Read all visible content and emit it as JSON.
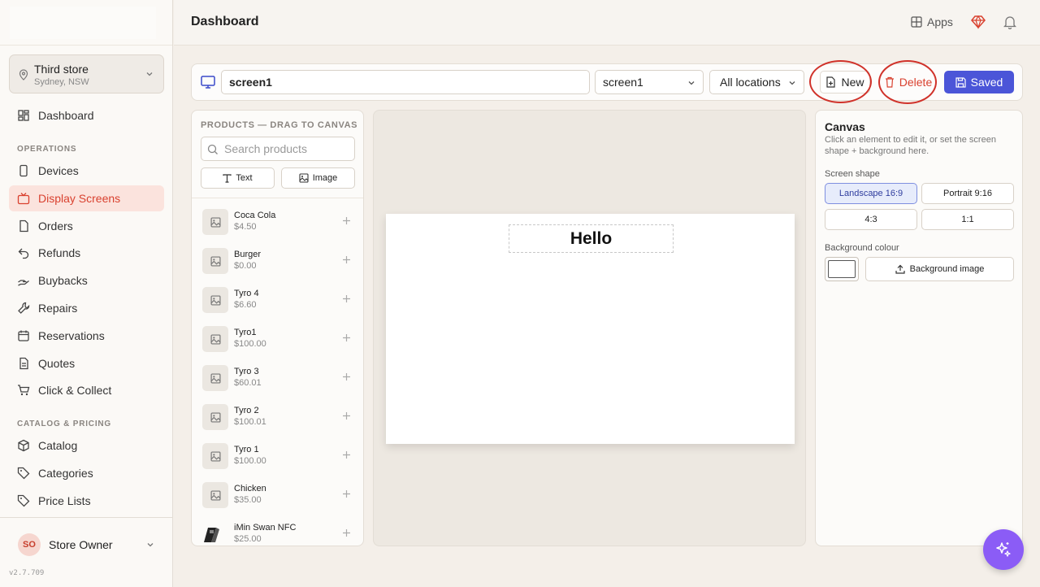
{
  "sidebar": {
    "store": {
      "name": "Third store",
      "location": "Sydney, NSW"
    },
    "items": [
      {
        "label": "Dashboard",
        "icon": "dashboard-icon"
      },
      {
        "label": "Devices",
        "icon": "device-icon"
      },
      {
        "label": "Display Screens",
        "icon": "tv-icon",
        "active": true
      },
      {
        "label": "Orders",
        "icon": "file-icon"
      },
      {
        "label": "Refunds",
        "icon": "undo-icon"
      },
      {
        "label": "Buybacks",
        "icon": "hand-icon"
      },
      {
        "label": "Repairs",
        "icon": "wrench-icon"
      },
      {
        "label": "Reservations",
        "icon": "calendar-icon"
      },
      {
        "label": "Quotes",
        "icon": "document-icon"
      },
      {
        "label": "Click & Collect",
        "icon": "cart-icon"
      },
      {
        "label": "Catalog",
        "icon": "package-icon"
      },
      {
        "label": "Categories",
        "icon": "tag-icon"
      },
      {
        "label": "Price Lists",
        "icon": "tag-icon"
      }
    ],
    "sections": {
      "operations": "OPERATIONS",
      "catalog": "CATALOG & PRICING"
    },
    "user": {
      "initials": "SO",
      "name": "Store Owner"
    },
    "version": "v2.7.709"
  },
  "header": {
    "title": "Dashboard",
    "apps_label": "Apps"
  },
  "toolbar": {
    "screen_name": "screen1",
    "screen_select": "screen1",
    "location_select": "All locations",
    "new_label": "New",
    "delete_label": "Delete",
    "saved_label": "Saved"
  },
  "products": {
    "heading": "PRODUCTS — DRAG TO CANVAS",
    "search_placeholder": "Search products",
    "text_tool": "Text",
    "image_tool": "Image",
    "items": [
      {
        "name": "Coca Cola",
        "price": "$4.50"
      },
      {
        "name": "Burger",
        "price": "$0.00"
      },
      {
        "name": "Tyro 4",
        "price": "$6.60"
      },
      {
        "name": "Tyro1",
        "price": "$100.00"
      },
      {
        "name": "Tyro 3",
        "price": "$60.01"
      },
      {
        "name": "Tyro 2",
        "price": "$100.01"
      },
      {
        "name": "Tyro 1",
        "price": "$100.00"
      },
      {
        "name": "Chicken",
        "price": "$35.00"
      },
      {
        "name": "iMin Swan NFC",
        "price": "$25.00"
      }
    ]
  },
  "canvas": {
    "text_element": "Hello",
    "background": "#ffffff"
  },
  "properties": {
    "title": "Canvas",
    "description": "Click an element to edit it, or set the screen shape + background here.",
    "shape_label": "Screen shape",
    "shapes": [
      "Landscape 16:9",
      "Portrait 9:16",
      "4:3",
      "1:1"
    ],
    "selected_shape": "Landscape 16:9",
    "bg_colour_label": "Background colour",
    "bg_image_label": "Background image"
  },
  "colors": {
    "accent": "#d9412f",
    "primary": "#4b55d8",
    "fab": "#8b5cf6"
  }
}
